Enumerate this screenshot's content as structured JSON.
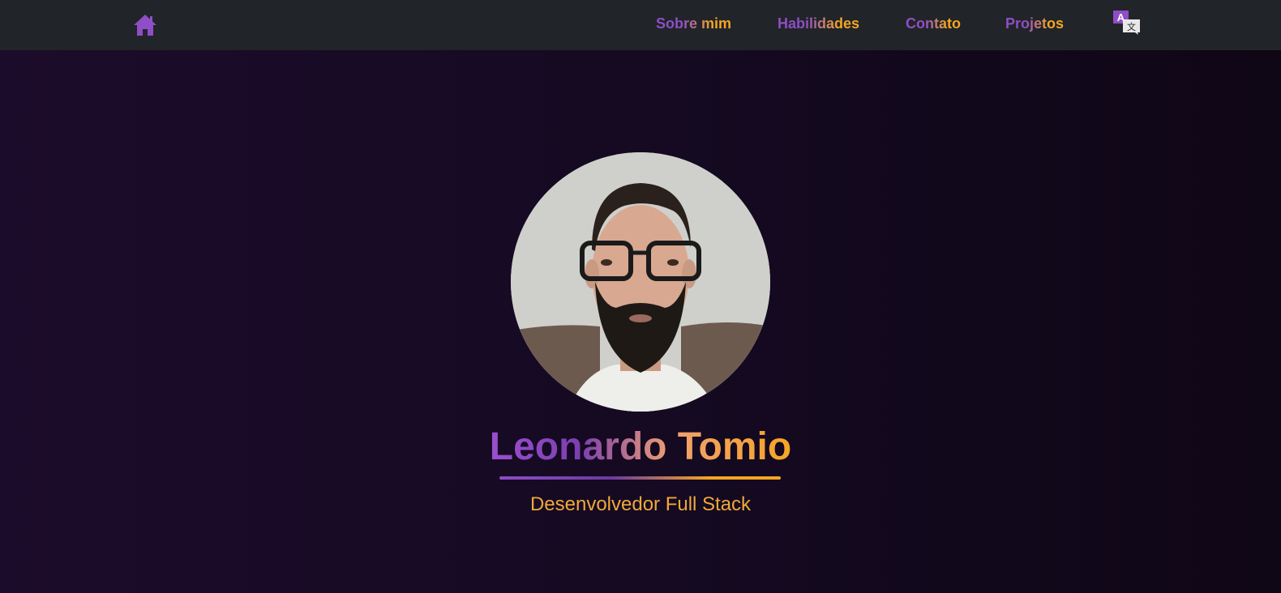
{
  "nav": {
    "home_icon": "home-icon",
    "links": [
      {
        "label": "Sobre mim"
      },
      {
        "label": "Habilidades"
      },
      {
        "label": "Contato"
      },
      {
        "label": "Projetos"
      }
    ],
    "language_icon": "translate-icon",
    "language_glyph": "A",
    "language_glyph_secondary": "文"
  },
  "hero": {
    "name": "Leonardo Tomio",
    "role": "Desenvolvedor Full Stack",
    "avatar_icon": "profile-photo"
  },
  "colors": {
    "nav_bg": "#212428",
    "accent_purple": "#8e4ec6",
    "accent_orange": "#f5a623",
    "bg_dark": "#150a22"
  }
}
